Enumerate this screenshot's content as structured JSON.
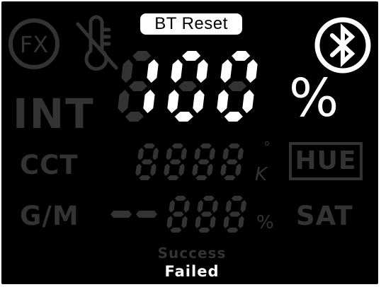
{
  "theme": {
    "on": "#ffffff",
    "dim": "#333333",
    "background": "#000000"
  },
  "header": {
    "fx_icon": "fx-circle-icon",
    "thermo_icon": "thermometer-off-icon",
    "bt_reset_label": "BT Reset",
    "bluetooth_icon": "bluetooth-icon"
  },
  "main_display": {
    "digits": [
      "1",
      "0",
      "0"
    ],
    "value": "100",
    "unit": "%",
    "mode_label": "INT"
  },
  "cct_row": {
    "label": "CCT",
    "digits": [
      "8",
      "8",
      "8",
      "8"
    ],
    "degree_symbol": "°",
    "unit": "K"
  },
  "gm_row": {
    "label": "G/M",
    "prefix": "--",
    "digits": [
      "8",
      "8",
      "8"
    ],
    "unit": "%"
  },
  "side": {
    "hue_label": "HUE",
    "sat_label": "SAT"
  },
  "status": {
    "success_label": "Success",
    "failed_label": "Failed",
    "active": "failed"
  }
}
